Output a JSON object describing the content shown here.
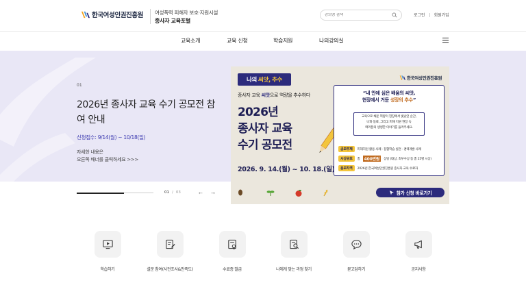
{
  "header": {
    "logo_text": "한국여성인권진흥원",
    "portal_line1": "여성폭력 피해자 보호·지원시설",
    "portal_line2": "종사자 교육포털",
    "search_placeholder": "강의명 검색",
    "login": "로그인",
    "signup": "회원가입"
  },
  "nav": [
    "교육소개",
    "교육 신청",
    "학습지원",
    "나의강의실"
  ],
  "slide": {
    "number": "01",
    "title": "2026년 종사자 교육 수기 공모전 참여 안내",
    "period": "신청접수: 9/14(월) ~ 10/18(일)",
    "desc_line1": "자세한 내용은",
    "desc_line2": "오른쪽 배너를 클릭하세요 >>>",
    "current": "01",
    "total": "03",
    "progress_fraction": 0.62
  },
  "banner": {
    "badge_prefix": "나의",
    "badge_word": "씨앗,",
    "badge_suffix": "추수",
    "logo_text": "한국여성인권진흥원",
    "subtitle_prefix": "종사자 교육",
    "subtitle_bold": "씨앗",
    "subtitle_suffix": "으로 역량을 추수하다",
    "title_line1": "2026년",
    "title_line2": "종사자 교육",
    "title_line3": "수기 공모전",
    "date": "2026. 9. 14.(월) ~ 10. 18.(일)",
    "quote_line1": "“내 안에 심은 배움의 씨앗,",
    "quote_line2_prefix": "현장에서 거둔 ",
    "quote_line2_hl": "성장의 추수",
    "quote_line2_suffix": "”",
    "body_line1": "교육으로 채운 역량이 현장에서 빛났던 순간,",
    "body_line2": "나와 동료, 그리고 피해 지원 현장 속",
    "body_line3": "여러분의 생생한 이야기를 들려주세요.",
    "rows": [
      {
        "tag": "공모주제",
        "text": "피해지원 활용 사례 · 집합학습 실천 · 경력개발 사례",
        "hl": ""
      },
      {
        "tag": "시상규모",
        "text_prefix": "총",
        "hl": "400만원",
        "text": "상당 (대상, 최우수상 등 총 25명 시상)"
      },
      {
        "tag": "응모자격",
        "text": "2026년 한국여성인권진흥원 종사자 교육 수료자",
        "hl": ""
      }
    ],
    "cta": "참가 신청 바로가기"
  },
  "quick_menu": [
    {
      "label": "학습하기",
      "icon": "video-lesson-icon"
    },
    {
      "label": "설문 참여(사전조사&만족도)",
      "icon": "survey-edit-icon"
    },
    {
      "label": "수료증 발급",
      "icon": "certificate-icon"
    },
    {
      "label": "나에게 맞는 과정 찾기",
      "icon": "search-document-icon"
    },
    {
      "label": "묻고답하기",
      "icon": "chat-bubble-icon"
    },
    {
      "label": "공지사항",
      "icon": "megaphone-icon"
    }
  ],
  "colors": {
    "primary": "#2c2b7c",
    "visual_bg": "#e9e7f6",
    "accent_yellow": "#f3c53c",
    "accent_orange": "#c06a1e"
  }
}
